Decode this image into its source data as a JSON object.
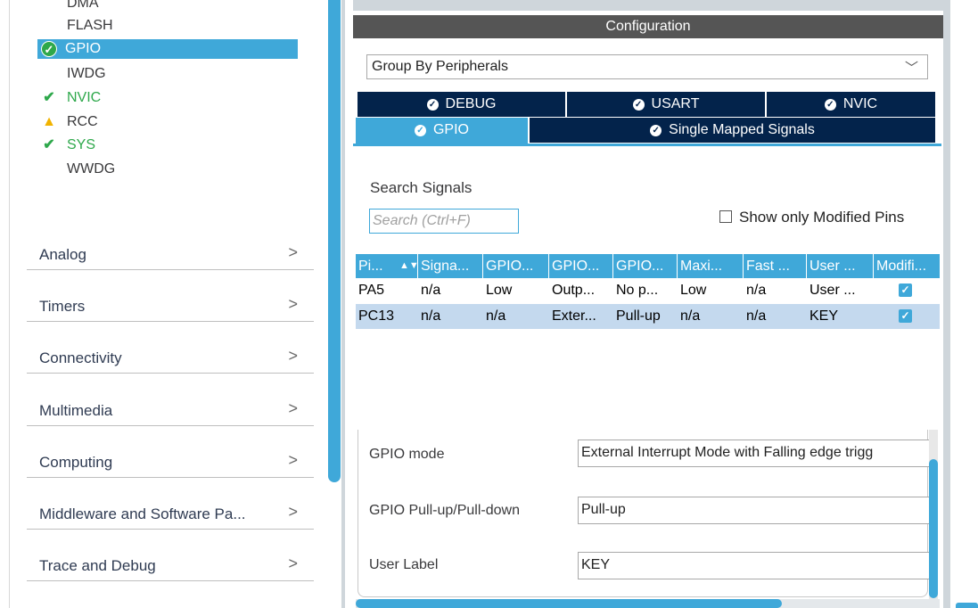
{
  "system_items": [
    {
      "label": "DMA",
      "status": "none"
    },
    {
      "label": "FLASH",
      "status": "none"
    },
    {
      "label": "GPIO",
      "status": "ok",
      "selected": true
    },
    {
      "label": "IWDG",
      "status": "none"
    },
    {
      "label": "NVIC",
      "status": "ok"
    },
    {
      "label": "RCC",
      "status": "warning"
    },
    {
      "label": "SYS",
      "status": "ok"
    },
    {
      "label": "WWDG",
      "status": "none"
    }
  ],
  "categories": [
    {
      "label": "Analog",
      "chevron": ">"
    },
    {
      "label": "Timers",
      "chevron": ">"
    },
    {
      "label": "Connectivity",
      "chevron": ">"
    },
    {
      "label": "Multimedia",
      "chevron": ">"
    },
    {
      "label": "Computing",
      "chevron": ">"
    },
    {
      "label": "Middleware and Software Pa...",
      "chevron": ">"
    },
    {
      "label": "Trace and Debug",
      "chevron": ">"
    }
  ],
  "config": {
    "title": "Configuration",
    "group_by": "Group By Peripherals",
    "tabs_row1": [
      "DEBUG",
      "USART",
      "NVIC"
    ],
    "tabs_row2": [
      "GPIO",
      "Single Mapped Signals"
    ],
    "active_tab": "GPIO",
    "search_label": "Search Signals",
    "search_placeholder": "Search (Ctrl+F)",
    "show_modified_label": "Show only Modified Pins",
    "show_modified_checked": false
  },
  "table": {
    "headers": [
      "Pi...",
      "Signa...",
      "GPIO...",
      "GPIO...",
      "GPIO...",
      "Maxi...",
      "Fast ...",
      "User ...",
      "Modifi..."
    ],
    "sort_icon": "sort-icon",
    "rows": [
      {
        "cells": [
          "PA5",
          "n/a",
          "Low",
          "Outp...",
          "No p...",
          "Low",
          "n/a",
          "User ..."
        ],
        "modified": true,
        "selected": false
      },
      {
        "cells": [
          "PC13",
          "n/a",
          "n/a",
          "Exter...",
          "Pull-up",
          "n/a",
          "n/a",
          "KEY"
        ],
        "modified": true,
        "selected": true
      }
    ]
  },
  "details": [
    {
      "label": "GPIO mode",
      "value": "External Interrupt Mode with Falling edge trigg"
    },
    {
      "label": "GPIO Pull-up/Pull-down",
      "value": "Pull-up"
    },
    {
      "label": "User Label",
      "value": "KEY"
    }
  ],
  "colors": {
    "accent": "#3fa8d9",
    "tab_dark": "#03234b",
    "ok_green": "#2ea84b",
    "warning": "#f1b300",
    "header_gray": "#555555"
  }
}
